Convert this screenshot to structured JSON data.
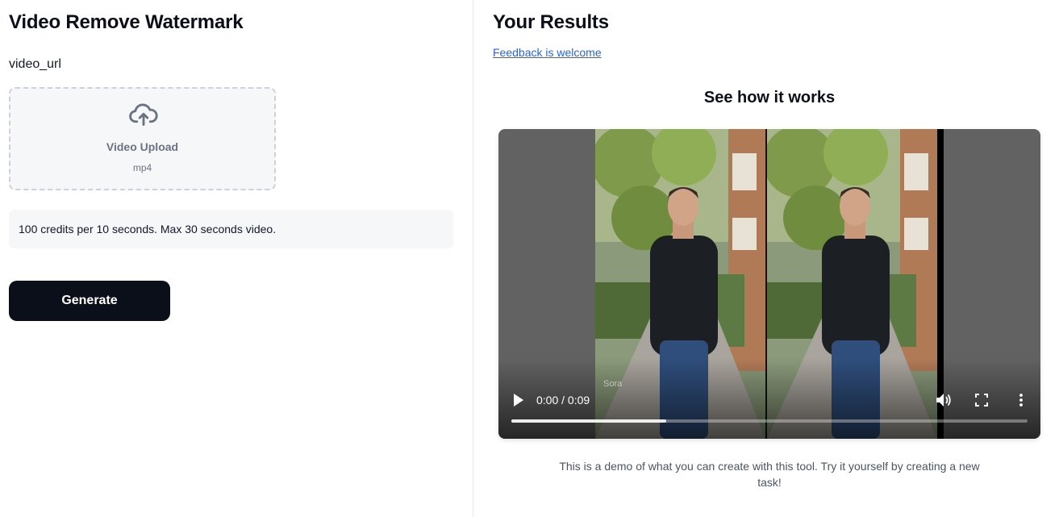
{
  "left": {
    "title": "Video Remove Watermark",
    "field_label": "video_url",
    "upload": {
      "title": "Video Upload",
      "formats": "mp4",
      "icon": "cloud-upload-icon"
    },
    "info_text": "100 credits per 10 seconds. Max 30 seconds video.",
    "generate_label": "Generate"
  },
  "right": {
    "title": "Your Results",
    "feedback_link": "Feedback is welcome",
    "demo_heading": "See how it works",
    "video": {
      "time": "0:00 / 0:09",
      "watermark": "Sora",
      "progress": 0.3,
      "controls": [
        "play-icon",
        "volume-icon",
        "fullscreen-icon",
        "more-options-icon"
      ]
    },
    "caption": "This is a demo of what you can create with this tool. Try it yourself by creating a new task!"
  },
  "colors": {
    "button_bg": "#0b0f19",
    "link": "#2563eb",
    "panel_bg": "#f6f7f9",
    "upload_border": "#cbd2dc"
  }
}
